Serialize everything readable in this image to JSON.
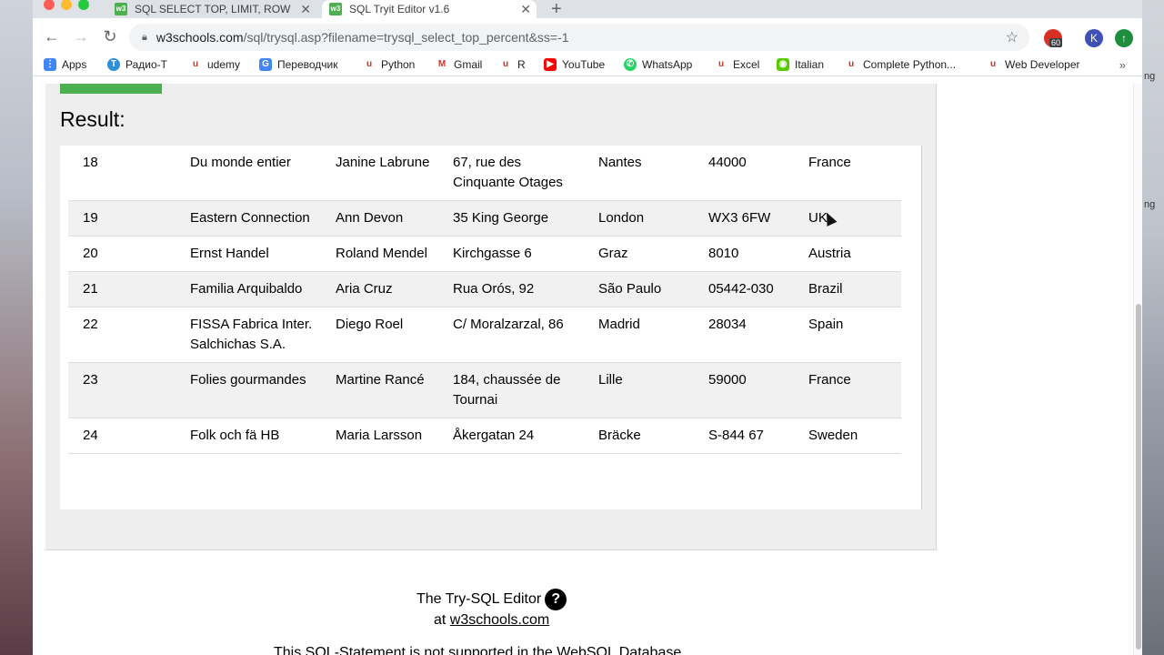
{
  "browser": {
    "tabs": [
      {
        "title": "SQL SELECT TOP, LIMIT, ROWNUM",
        "active": false
      },
      {
        "title": "SQL Tryit Editor v1.6",
        "active": true
      }
    ],
    "new_tab_label": "+",
    "url_host": "w3schools.com",
    "url_path": "/sql/trysql.asp?filename=trysql_select_top_percent&ss=-1",
    "extension_badge": "60",
    "profile_initial": "K"
  },
  "bookmarks": [
    {
      "label": "Apps",
      "icon": "apps-grid-icon",
      "color": "#4285f4"
    },
    {
      "label": "Радио-Т",
      "icon": "radio-t-icon",
      "color": "#2f8fd8"
    },
    {
      "label": "udemy",
      "icon": "udemy-icon",
      "color": "#c0392b"
    },
    {
      "label": "Переводчик",
      "icon": "translate-icon",
      "color": "#4285f4"
    },
    {
      "label": "Python",
      "icon": "udemy-icon",
      "color": "#c0392b"
    },
    {
      "label": "Gmail",
      "icon": "gmail-icon",
      "color": "#d93025"
    },
    {
      "label": "R",
      "icon": "udemy-icon",
      "color": "#c0392b"
    },
    {
      "label": "YouTube",
      "icon": "youtube-icon",
      "color": "#ff0000"
    },
    {
      "label": "WhatsApp",
      "icon": "whatsapp-icon",
      "color": "#25d366"
    },
    {
      "label": "Excel",
      "icon": "udemy-icon",
      "color": "#c0392b"
    },
    {
      "label": "Italian",
      "icon": "duolingo-icon",
      "color": "#58cc02"
    },
    {
      "label": "Complete Python...",
      "icon": "udemy-icon",
      "color": "#c0392b"
    },
    {
      "label": "Web Developer",
      "icon": "udemy-icon",
      "color": "#c0392b"
    }
  ],
  "bookmarks_more": "»",
  "result": {
    "title": "Result:",
    "rows": [
      {
        "id": "18",
        "name": "Du monde entier",
        "contact": "Janine Labrune",
        "address": "67, rue des Cinquante Otages",
        "city": "Nantes",
        "postal": "44000",
        "country": "France"
      },
      {
        "id": "19",
        "name": "Eastern Connection",
        "contact": "Ann Devon",
        "address": "35 King George",
        "city": "London",
        "postal": "WX3 6FW",
        "country": "UK"
      },
      {
        "id": "20",
        "name": "Ernst Handel",
        "contact": "Roland Mendel",
        "address": "Kirchgasse 6",
        "city": "Graz",
        "postal": "8010",
        "country": "Austria"
      },
      {
        "id": "21",
        "name": "Familia Arquibaldo",
        "contact": "Aria Cruz",
        "address": "Rua Orós, 92",
        "city": "São Paulo",
        "postal": "05442-030",
        "country": "Brazil"
      },
      {
        "id": "22",
        "name": "FISSA Fabrica Inter. Salchichas S.A.",
        "contact": "Diego Roel",
        "address": "C/ Moralzarzal, 86",
        "city": "Madrid",
        "postal": "28034",
        "country": "Spain"
      },
      {
        "id": "23",
        "name": "Folies gourmandes",
        "contact": "Martine Rancé",
        "address": "184, chaussée de Tournai",
        "city": "Lille",
        "postal": "59000",
        "country": "France"
      },
      {
        "id": "24",
        "name": "Folk och fä HB",
        "contact": "Maria Larsson",
        "address": "Åkergatan 24",
        "city": "Bräcke",
        "postal": "S-844 67",
        "country": "Sweden"
      }
    ]
  },
  "footer": {
    "editor_label": "The Try-SQL Editor",
    "help_icon": "?",
    "at_label": "at",
    "site_link": "w3schools.com",
    "notice": "This SQL-Statement is not supported in the WebSQL Database."
  },
  "desktop_right_labels": [
    "ng",
    "ng"
  ]
}
